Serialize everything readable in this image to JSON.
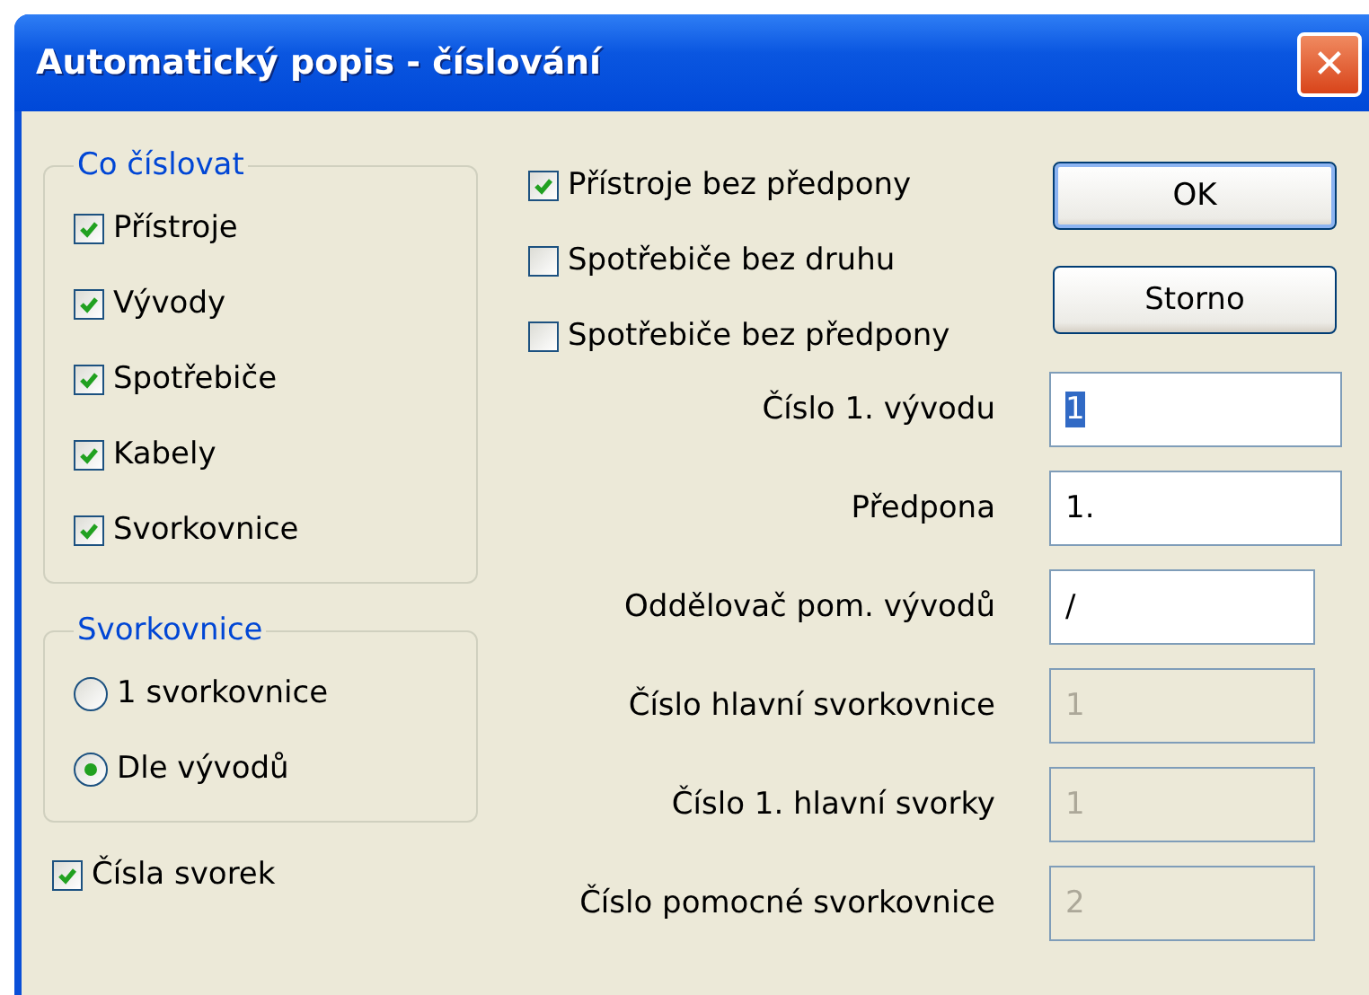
{
  "window": {
    "title": "Automatický popis - číslování",
    "close": "✕"
  },
  "groups": [
    {
      "title": "Co číslovat",
      "kind": "checkbox",
      "items": [
        {
          "label": "Přístroje",
          "checked": true
        },
        {
          "label": "Vývody",
          "checked": true
        },
        {
          "label": "Spotřebiče",
          "checked": true
        },
        {
          "label": "Kabely",
          "checked": true
        },
        {
          "label": "Svorkovnice",
          "checked": true
        }
      ]
    },
    {
      "title": "Svorkovnice",
      "kind": "radio",
      "items": [
        {
          "label": "1 svorkovnice",
          "selected": false
        },
        {
          "label": "Dle vývodů",
          "selected": true
        }
      ]
    }
  ],
  "bottom_checkbox": {
    "label": "Čísla svorek",
    "checked": true
  },
  "options": [
    {
      "label": "Přístroje bez předpony",
      "checked": true
    },
    {
      "label": "Spotřebiče bez druhu",
      "checked": false
    },
    {
      "label": "Spotřebiče bez předpony",
      "checked": false
    }
  ],
  "buttons": [
    "OK",
    "Storno"
  ],
  "fields": [
    {
      "label": "Číslo 1. vývodu",
      "value": "1",
      "disabled": false,
      "highlighted": true
    },
    {
      "label": "Předpona",
      "value": "1.",
      "disabled": false,
      "highlighted": false
    },
    {
      "label": "Oddělovač pom. vývodů",
      "value": "/",
      "disabled": false,
      "highlighted": false
    },
    {
      "label": "Číslo hlavní svorkovnice",
      "value": "1",
      "disabled": true,
      "highlighted": false
    },
    {
      "label": "Číslo 1. hlavní svorky",
      "value": "1",
      "disabled": true,
      "highlighted": false
    },
    {
      "label": "Číslo pomocné svorkovnice",
      "value": "2",
      "disabled": true,
      "highlighted": false
    }
  ]
}
